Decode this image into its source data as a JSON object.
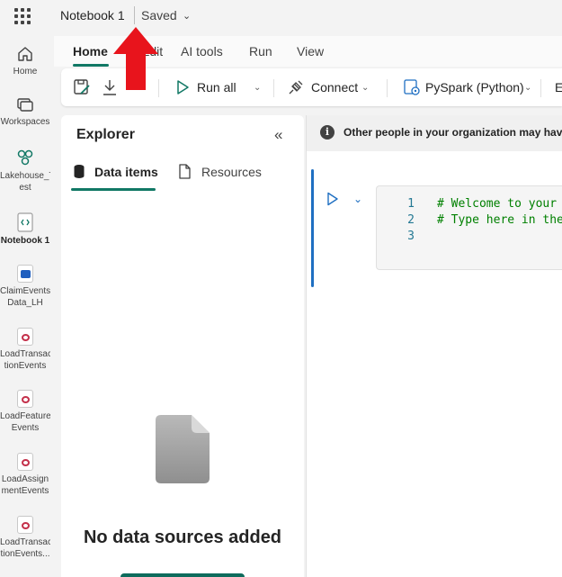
{
  "topbar": {
    "app_launcher_icon": "waffle-grid-icon",
    "notebook_title": "Notebook 1",
    "save_status": "Saved"
  },
  "rail": {
    "items": [
      {
        "label": "Home",
        "icon": "home-icon"
      },
      {
        "label": "Workspaces",
        "icon": "workspaces-icon"
      },
      {
        "label_line1": "Lakehouse_T",
        "label_line2": "est",
        "icon": "lakehouse-icon"
      },
      {
        "label": "Notebook 1",
        "icon": "notebook-icon"
      },
      {
        "label_line1": "ClaimEvents",
        "label_line2": "Data_LH",
        "icon": "lakehouse-file-icon"
      },
      {
        "label_line1": "LoadTransac",
        "label_line2": "tionEvents",
        "icon": "notebook-pink-icon"
      },
      {
        "label_line1": "LoadFeature",
        "label_line2": "Events",
        "icon": "notebook-pink-icon"
      },
      {
        "label_line1": "LoadAssign",
        "label_line2": "mentEvents",
        "icon": "notebook-pink-icon"
      },
      {
        "label_line1": "LoadTransac",
        "label_line2": "tionEvents...",
        "icon": "notebook-pink-icon"
      }
    ]
  },
  "ribbon": {
    "tabs": [
      "Home",
      "Edit",
      "AI tools",
      "Run",
      "View"
    ],
    "active_tab": "Home",
    "toolbar": {
      "run_all": "Run all",
      "connect": "Connect",
      "language": "PySpark (Python)",
      "overflow": "E"
    }
  },
  "explorer": {
    "title": "Explorer",
    "tabs": [
      "Data items",
      "Resources"
    ],
    "active_tab": "Data items",
    "empty_message": "No data sources added"
  },
  "editor": {
    "info_banner": "Other people in your organization may have",
    "code_lines": [
      {
        "number": "1",
        "text": "# Welcome to your n"
      },
      {
        "number": "2",
        "text": "# Type here in the"
      },
      {
        "number": "3",
        "text": ""
      }
    ]
  },
  "colors": {
    "accent": "#117865",
    "annotation_arrow": "#e8141c",
    "cell_focus": "#1f6fc2"
  }
}
